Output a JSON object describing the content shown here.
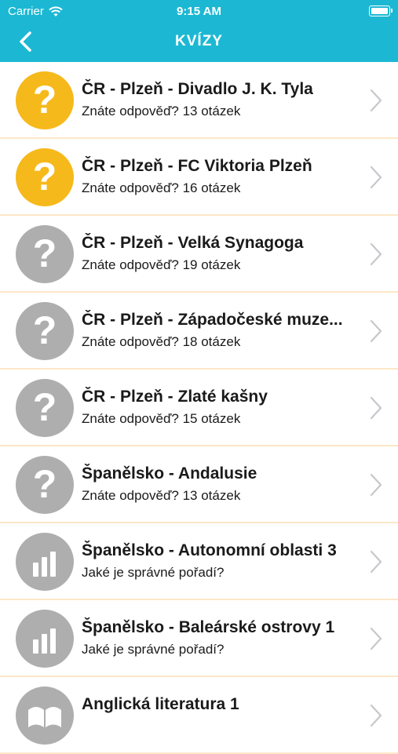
{
  "status_bar": {
    "carrier": "Carrier",
    "time": "9:15 AM"
  },
  "nav": {
    "title": "KVÍZY"
  },
  "colors": {
    "accent": "#1cb8d3",
    "solved": "#f6b91b",
    "unsolved": "#aeaeae",
    "separator": "#fde7c8"
  },
  "quizzes": [
    {
      "title": "ČR - Plzeň - Divadlo J. K. Tyla",
      "subtitle": "Znáte odpověď? 13 otázek",
      "icon": "question-icon",
      "state": "solved"
    },
    {
      "title": "ČR - Plzeň - FC Viktoria Plzeň",
      "subtitle": "Znáte odpověď? 16 otázek",
      "icon": "question-icon",
      "state": "solved"
    },
    {
      "title": "ČR - Plzeň - Velká Synagoga",
      "subtitle": "Znáte odpověď? 19 otázek",
      "icon": "question-icon",
      "state": "unsolved"
    },
    {
      "title": "ČR - Plzeň - Západočeské muze...",
      "subtitle": "Znáte odpověď? 18 otázek",
      "icon": "question-icon",
      "state": "unsolved"
    },
    {
      "title": "ČR - Plzeň - Zlaté kašny",
      "subtitle": "Znáte odpověď? 15 otázek",
      "icon": "question-icon",
      "state": "unsolved"
    },
    {
      "title": "Španělsko - Andalusie",
      "subtitle": "Znáte odpověď? 13 otázek",
      "icon": "question-icon",
      "state": "unsolved"
    },
    {
      "title": "Španělsko - Autonomní oblasti 3",
      "subtitle": "Jaké je správné pořadí?",
      "icon": "bar-chart-icon",
      "state": "unsolved"
    },
    {
      "title": "Španělsko - Baleárské ostrovy 1",
      "subtitle": "Jaké je správné pořadí?",
      "icon": "bar-chart-icon",
      "state": "unsolved"
    },
    {
      "title": "Anglická literatura 1",
      "subtitle": "",
      "icon": "book-icon",
      "state": "unsolved"
    }
  ]
}
